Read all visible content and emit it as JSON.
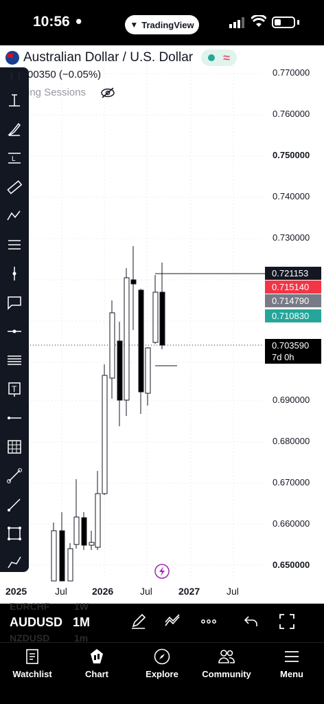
{
  "status_bar": {
    "time": "10:56",
    "app_pill": "TradingView"
  },
  "header": {
    "title": "Australian Dollar / U.S. Dollar",
    "price_change": "00350 (−0.05%)",
    "sessions_label": "ing Sessions"
  },
  "price_axis": {
    "labels": [
      "0.770000",
      "0.760000",
      "0.750000",
      "0.740000",
      "0.730000",
      "0.690000",
      "0.680000",
      "0.670000",
      "0.660000",
      "0.650000"
    ],
    "tags": {
      "high": "0.721153",
      "red": "0.715140",
      "gray": "0.714790",
      "green": "0.710830",
      "last": "0.703590",
      "countdown": "7d 0h"
    }
  },
  "time_axis": {
    "labels": [
      "2025",
      "Jul",
      "2026",
      "Jul",
      "2027",
      "Jul"
    ]
  },
  "symbol_bar": {
    "ghost_top": "EURCHF",
    "ghost_top_interval": "1W",
    "symbol": "AUDUSD",
    "interval": "1M",
    "ghost_bottom": "NZDUSD",
    "ghost_bottom_interval": "1m"
  },
  "nav": [
    {
      "label": "Watchlist",
      "icon": "watchlist-icon"
    },
    {
      "label": "Chart",
      "icon": "chart-icon"
    },
    {
      "label": "Explore",
      "icon": "compass-icon"
    },
    {
      "label": "Community",
      "icon": "community-icon"
    },
    {
      "label": "Menu",
      "icon": "menu-icon"
    }
  ],
  "colors": {
    "up": "#ffffff",
    "down": "#000000",
    "red_tag": "#f23645",
    "green_tag": "#26a69a",
    "gray_tag": "#787b86"
  }
}
